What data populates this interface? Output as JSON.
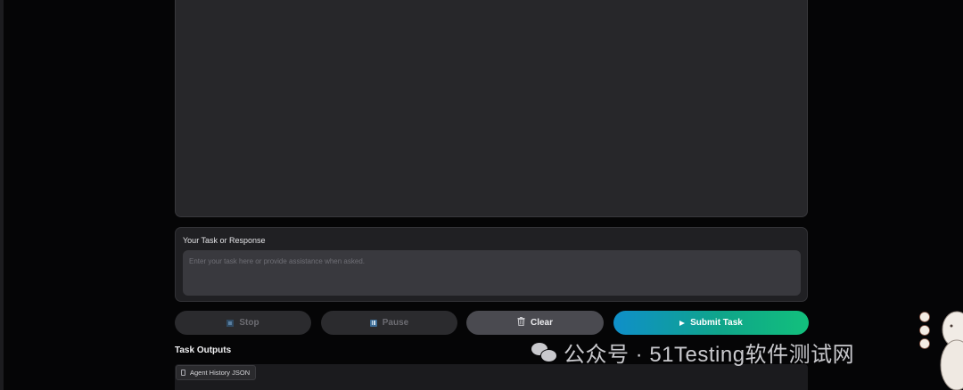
{
  "task_card": {
    "label": "Your Task or Response",
    "placeholder": "Enter your task here or provide assistance when asked."
  },
  "buttons": {
    "stop": "Stop",
    "pause": "Pause",
    "clear": "Clear",
    "submit": "Submit Task"
  },
  "outputs": {
    "title": "Task Outputs",
    "tab_label": "Agent History JSON"
  },
  "watermark": {
    "text": "公众号 · 51Testing软件测试网"
  },
  "icons": {
    "stop": "stop-square-icon",
    "pause": "pause-icon",
    "clear": "trash-icon",
    "submit": "play-icon",
    "file": "file-icon",
    "wechat": "wechat-icon"
  },
  "colors": {
    "background": "#050506",
    "panel": "#27272a",
    "input": "#39393e",
    "submit_start": "#0f8fc9",
    "submit_end": "#12c07c"
  }
}
